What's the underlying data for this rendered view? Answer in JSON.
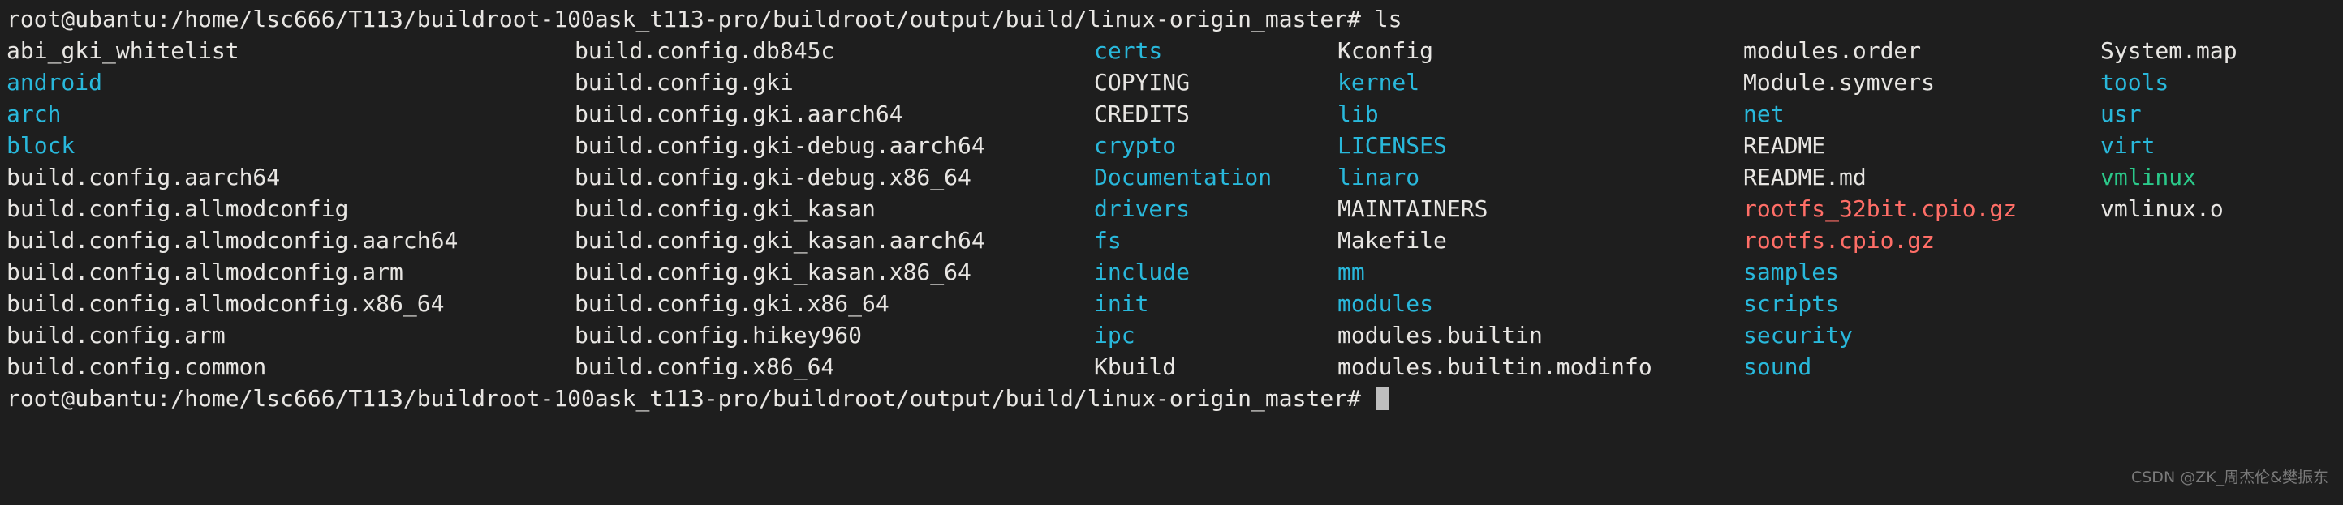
{
  "terminal": {
    "background_color": "#1e1e1e",
    "foreground_color": "#e8e6e3",
    "colors": {
      "file": "#e8e6e3",
      "directory": "#29b8db",
      "archive": "#ff6e67",
      "executable": "#2bc98a"
    },
    "prompt_top": "root@ubantu:/home/lsc666/T113/buildroot-100ask_t113-pro/buildroot/output/build/linux-origin_master# ls",
    "prompt_bottom": "root@ubantu:/home/lsc666/T113/buildroot-100ask_t113-pro/buildroot/output/build/linux-origin_master# ",
    "command": "ls",
    "user_host_path": "root@ubantu:/home/lsc666/T113/buildroot-100ask_t113-pro/buildroot/output/build/linux-origin_master#",
    "cursor": "block"
  },
  "listing": {
    "rows": [
      [
        {
          "name": "abi_gki_whitelist",
          "type": "file"
        },
        {
          "name": "build.config.db845c",
          "type": "file"
        },
        {
          "name": "certs",
          "type": "dir"
        },
        {
          "name": "Kconfig",
          "type": "file"
        },
        {
          "name": "modules.order",
          "type": "file"
        },
        {
          "name": "System.map",
          "type": "file"
        }
      ],
      [
        {
          "name": "android",
          "type": "dir"
        },
        {
          "name": "build.config.gki",
          "type": "file"
        },
        {
          "name": "COPYING",
          "type": "file"
        },
        {
          "name": "kernel",
          "type": "dir"
        },
        {
          "name": "Module.symvers",
          "type": "file"
        },
        {
          "name": "tools",
          "type": "dir"
        }
      ],
      [
        {
          "name": "arch",
          "type": "dir"
        },
        {
          "name": "build.config.gki.aarch64",
          "type": "file"
        },
        {
          "name": "CREDITS",
          "type": "file"
        },
        {
          "name": "lib",
          "type": "dir"
        },
        {
          "name": "net",
          "type": "dir"
        },
        {
          "name": "usr",
          "type": "dir"
        }
      ],
      [
        {
          "name": "block",
          "type": "dir"
        },
        {
          "name": "build.config.gki-debug.aarch64",
          "type": "file"
        },
        {
          "name": "crypto",
          "type": "dir"
        },
        {
          "name": "LICENSES",
          "type": "dir"
        },
        {
          "name": "README",
          "type": "file"
        },
        {
          "name": "virt",
          "type": "dir"
        }
      ],
      [
        {
          "name": "build.config.aarch64",
          "type": "file"
        },
        {
          "name": "build.config.gki-debug.x86_64",
          "type": "file"
        },
        {
          "name": "Documentation",
          "type": "dir"
        },
        {
          "name": "linaro",
          "type": "dir"
        },
        {
          "name": "README.md",
          "type": "file"
        },
        {
          "name": "vmlinux",
          "type": "exec"
        }
      ],
      [
        {
          "name": "build.config.allmodconfig",
          "type": "file"
        },
        {
          "name": "build.config.gki_kasan",
          "type": "file"
        },
        {
          "name": "drivers",
          "type": "dir"
        },
        {
          "name": "MAINTAINERS",
          "type": "file"
        },
        {
          "name": "rootfs_32bit.cpio.gz",
          "type": "archive"
        },
        {
          "name": "vmlinux.o",
          "type": "file"
        }
      ],
      [
        {
          "name": "build.config.allmodconfig.aarch64",
          "type": "file"
        },
        {
          "name": "build.config.gki_kasan.aarch64",
          "type": "file"
        },
        {
          "name": "fs",
          "type": "dir"
        },
        {
          "name": "Makefile",
          "type": "file"
        },
        {
          "name": "rootfs.cpio.gz",
          "type": "archive"
        },
        {
          "name": "",
          "type": "none"
        }
      ],
      [
        {
          "name": "build.config.allmodconfig.arm",
          "type": "file"
        },
        {
          "name": "build.config.gki_kasan.x86_64",
          "type": "file"
        },
        {
          "name": "include",
          "type": "dir"
        },
        {
          "name": "mm",
          "type": "dir"
        },
        {
          "name": "samples",
          "type": "dir"
        },
        {
          "name": "",
          "type": "none"
        }
      ],
      [
        {
          "name": "build.config.allmodconfig.x86_64",
          "type": "file"
        },
        {
          "name": "build.config.gki.x86_64",
          "type": "file"
        },
        {
          "name": "init",
          "type": "dir"
        },
        {
          "name": "modules",
          "type": "dir"
        },
        {
          "name": "scripts",
          "type": "dir"
        },
        {
          "name": "",
          "type": "none"
        }
      ],
      [
        {
          "name": "build.config.arm",
          "type": "file"
        },
        {
          "name": "build.config.hikey960",
          "type": "file"
        },
        {
          "name": "ipc",
          "type": "dir"
        },
        {
          "name": "modules.builtin",
          "type": "file"
        },
        {
          "name": "security",
          "type": "dir"
        },
        {
          "name": "",
          "type": "none"
        }
      ],
      [
        {
          "name": "build.config.common",
          "type": "file"
        },
        {
          "name": "build.config.x86_64",
          "type": "file"
        },
        {
          "name": "Kbuild",
          "type": "file"
        },
        {
          "name": "modules.builtin.modinfo",
          "type": "file"
        },
        {
          "name": "sound",
          "type": "dir"
        },
        {
          "name": "",
          "type": "none"
        }
      ]
    ]
  },
  "watermark": {
    "text": "CSDN @ZK_周杰伦&樊振东"
  }
}
